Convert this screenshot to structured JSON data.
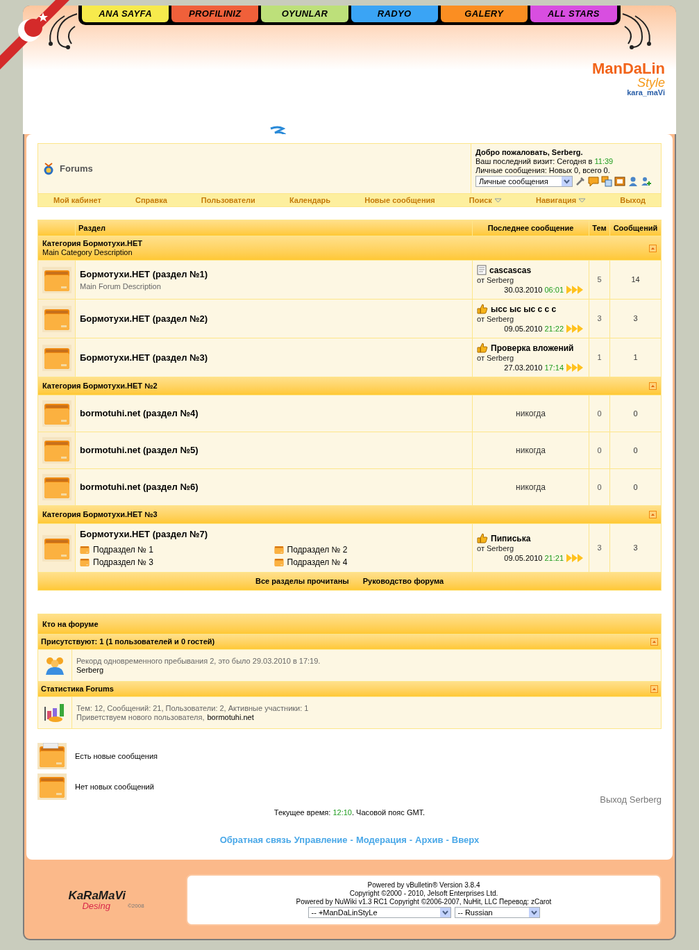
{
  "nav_tabs": [
    {
      "label": "ANA SAYFA",
      "color": "#f7ea4c"
    },
    {
      "label": "PROFILINIZ",
      "color": "#f0603a"
    },
    {
      "label": "OYUNLAR",
      "color": "#bde07a"
    },
    {
      "label": "RADYO",
      "color": "#3aa4f5"
    },
    {
      "label": "GALERY",
      "color": "#fb8e22"
    },
    {
      "label": "ALL STARS",
      "color": "#d84ee0"
    }
  ],
  "logo": {
    "name": "ManDaLin",
    "style": "Style",
    "tag": "kara_maVi"
  },
  "forum_header": {
    "title": "Forums",
    "welcome": "Добро пожаловать, Serberg.",
    "last_visit_label": "Ваш последний визит: Сегодня в",
    "last_visit_time": "11:39",
    "pm_info": "Личные сообщения: Новых 0, всего 0.",
    "pm_select": "Личные сообщения"
  },
  "navbar": [
    {
      "label": "Мой кабинет",
      "dropdown": false
    },
    {
      "label": "Справка",
      "dropdown": false
    },
    {
      "label": "Пользователи",
      "dropdown": false
    },
    {
      "label": "Календарь",
      "dropdown": false
    },
    {
      "label": "Новые сообщения",
      "dropdown": false
    },
    {
      "label": "Поиск",
      "dropdown": true
    },
    {
      "label": "Навигация",
      "dropdown": true
    },
    {
      "label": "Выход",
      "dropdown": false
    }
  ],
  "table": {
    "columns": [
      "Раздел",
      "Последнее сообщение",
      "Тем",
      "Сообщений"
    ],
    "categories": [
      {
        "title": "Категория Бормотухи.НЕТ",
        "description": "Main Category Description",
        "forums": [
          {
            "title": "Бормотухи.НЕТ (раздел №1)",
            "description": "Main Forum Description",
            "last_post": {
              "kind": "document",
              "title": "cascascas",
              "by": "от Serberg",
              "date": "30.03.2010",
              "time": "06:01"
            },
            "threads": "5",
            "posts": "14"
          },
          {
            "title": "Бормотухи.НЕТ (раздел №2)",
            "last_post": {
              "kind": "thumb",
              "title": "ысс ыс ыс с с с",
              "by": "от Serberg",
              "date": "09.05.2010",
              "time": "21:22"
            },
            "threads": "3",
            "posts": "3"
          },
          {
            "title": "Бормотухи.НЕТ (раздел №3)",
            "last_post": {
              "kind": "thumb",
              "title": "Проверка вложений",
              "by": "от Serberg",
              "date": "27.03.2010",
              "time": "17:14"
            },
            "threads": "1",
            "posts": "1"
          }
        ]
      },
      {
        "title": "Категория Бормотухи.НЕТ №2",
        "forums": [
          {
            "title": "bormotuhi.net (раздел №4)",
            "last_post_text": "никогда",
            "threads": "0",
            "posts": "0"
          },
          {
            "title": "bormotuhi.net (раздел №5)",
            "last_post_text": "никогда",
            "threads": "0",
            "posts": "0"
          },
          {
            "title": "bormotuhi.net (раздел №6)",
            "last_post_text": "никогда",
            "threads": "0",
            "posts": "0"
          }
        ]
      },
      {
        "title": "Категория Бормотухи.НЕТ №3",
        "forums": [
          {
            "title": "Бормотухи.НЕТ (раздел №7)",
            "subforums": [
              "Подраздел № 1",
              "Подраздел № 2",
              "Подраздел № 3",
              "Подраздел № 4"
            ],
            "last_post": {
              "kind": "thumb",
              "title": "Пиписька",
              "by": "от Serberg",
              "date": "09.05.2010",
              "time": "21:21"
            },
            "threads": "3",
            "posts": "3"
          }
        ]
      }
    ],
    "footer_links": [
      "Все разделы прочитаны",
      "Руководство форума"
    ]
  },
  "whos_online": {
    "title": "Кто на форуме",
    "sections": [
      {
        "kind": "users",
        "title": "Присутствуют: 1 (1 пользователей и 0 гостей)",
        "lines": [
          [
            {
              "text": "Рекорд одновременного пребывания 2, это было 29.03.2010 в 17:19.",
              "strong": false
            }
          ],
          [
            {
              "text": "Serberg",
              "strong": true
            }
          ]
        ]
      },
      {
        "kind": "stats",
        "title": "Статистика Forums",
        "lines": [
          [
            {
              "text": "Тем: 12, Сообщений: 21, Пользователи: 2, Активные участники: 1",
              "strong": false
            }
          ],
          [
            {
              "text": "Приветствуем нового пользователя,",
              "strong": false
            },
            {
              "text": "bormotuhi.net",
              "strong": true
            }
          ]
        ]
      }
    ]
  },
  "legend": [
    {
      "kind": "new",
      "label": "Есть новые сообщения"
    },
    {
      "kind": "old",
      "label": "Нет новых сообщений"
    }
  ],
  "logout": "Выход Serberg",
  "current_time": {
    "label": "Текущее время:",
    "time": "12:10",
    "suffix": ". Часовой пояс GMT."
  },
  "bottom_links": [
    {
      "label": "Обратная связь"
    },
    {
      "label": "Управление",
      "after": "-"
    },
    {
      "label": "Модерация",
      "after": "-"
    },
    {
      "label": "Архив",
      "after": "-"
    },
    {
      "label": "Вверх"
    }
  ],
  "footer_logo": {
    "name": "KaRaMaVi",
    "script": "Desing",
    "year": "©2008"
  },
  "footer": {
    "lines": [
      "Powered by vBulletin® Version 3.8.4",
      "Copyright ©2000 - 2010, Jelsoft Enterprises Ltd.",
      "Powered by NuWiki v1.3 RC1 Copyright ©2006-2007, NuHit, LLC Перевод: zCarot"
    ],
    "style_select": "-- +ManDaLinStyLe",
    "language_select": "-- Russian"
  }
}
